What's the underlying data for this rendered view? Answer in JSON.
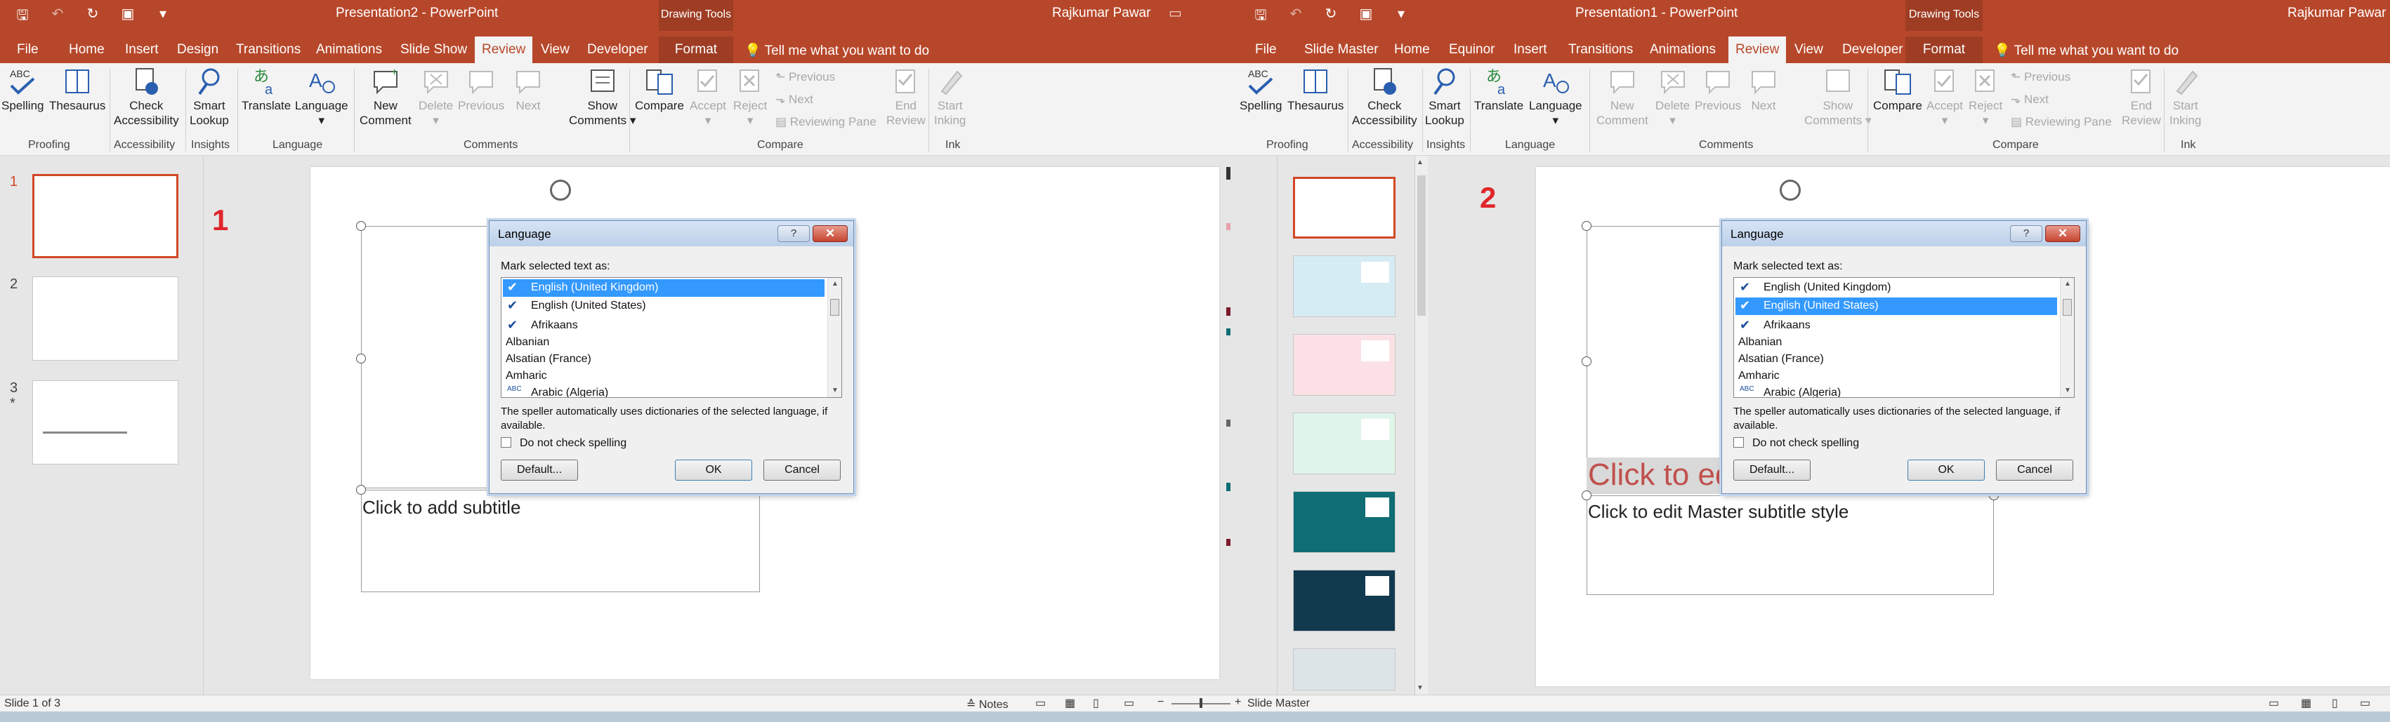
{
  "left_window": {
    "doc_title": "Presentation2 - PowerPoint",
    "context_title": "Drawing Tools",
    "user": "Rajkumar Pawar",
    "tabs": [
      "File",
      "Home",
      "Insert",
      "Design",
      "Transitions",
      "Animations",
      "Slide Show",
      "Review",
      "View",
      "Developer",
      "Format"
    ],
    "active_tab": "Review",
    "tell_me": "Tell me what you want to do",
    "slides": [
      "1",
      "2",
      "3"
    ],
    "slide3_marker": "*",
    "marker_number": "1",
    "subtitle_placeholder": "Click to add subtitle"
  },
  "right_window": {
    "doc_title": "Presentation1 - PowerPoint",
    "context_title": "Drawing Tools",
    "user": "Rajkumar Pawar",
    "tabs": [
      "File",
      "Slide Master",
      "Home",
      "Equinor",
      "Insert",
      "Transitions",
      "Animations",
      "Review",
      "View",
      "Developer",
      "Format"
    ],
    "active_tab": "Review",
    "tell_me": "Tell me what you want to do",
    "marker_number": "2",
    "title_placeholder": "Click to ed",
    "subtitle_placeholder": "Click to edit Master subtitle style"
  },
  "ribbon": {
    "spelling": "Spelling",
    "thesaurus": "Thesaurus",
    "check_accessibility_1": "Check",
    "check_accessibility_2": "Accessibility",
    "smart_lookup_1": "Smart",
    "smart_lookup_2": "Lookup",
    "translate": "Translate",
    "language": "Language",
    "new_comment_1": "New",
    "new_comment_2": "Comment",
    "delete": "Delete",
    "previous": "Previous",
    "next": "Next",
    "show_comments_1": "Show",
    "show_comments_2": "Comments",
    "compare": "Compare",
    "accept": "Accept",
    "reject": "Reject",
    "previous_small": "Previous",
    "next_small": "Next",
    "reviewing_pane": "Reviewing Pane",
    "end_review_1": "End",
    "end_review_2": "Review",
    "start_inking_1": "Start",
    "start_inking_2": "Inking",
    "groups": {
      "proofing": "Proofing",
      "accessibility": "Accessibility",
      "insights": "Insights",
      "language": "Language",
      "comments": "Comments",
      "compare": "Compare",
      "ink": "Ink"
    }
  },
  "dialog_left": {
    "title": "Language",
    "help": "?",
    "close": "✕",
    "label": "Mark selected text as:",
    "items": [
      {
        "name": "English (United Kingdom)",
        "check": "✔"
      },
      {
        "name": "English (United States)",
        "check": "✔"
      },
      {
        "name": "Afrikaans",
        "check": "✔"
      },
      {
        "name": "Albanian",
        "check": ""
      },
      {
        "name": "Alsatian (France)",
        "check": ""
      },
      {
        "name": "Amharic",
        "check": ""
      },
      {
        "name": "Arabic (Algeria)",
        "check": "ABC"
      }
    ],
    "selected_index": 0,
    "note": "The speller automatically uses dictionaries of the selected language, if available.",
    "do_not_check": "Do not check spelling",
    "default_btn": "Default...",
    "ok_btn": "OK",
    "cancel_btn": "Cancel"
  },
  "dialog_right": {
    "title": "Language",
    "help": "?",
    "close": "✕",
    "label": "Mark selected text as:",
    "items": [
      {
        "name": "English (United Kingdom)",
        "check": "✔"
      },
      {
        "name": "English (United States)",
        "check": "✔"
      },
      {
        "name": "Afrikaans",
        "check": "✔"
      },
      {
        "name": "Albanian",
        "check": ""
      },
      {
        "name": "Alsatian (France)",
        "check": ""
      },
      {
        "name": "Amharic",
        "check": ""
      },
      {
        "name": "Arabic (Algeria)",
        "check": "ABC"
      }
    ],
    "selected_index": 1,
    "note": "The speller automatically uses dictionaries of the selected language, if available.",
    "do_not_check": "Do not check spelling",
    "default_btn": "Default...",
    "ok_btn": "OK",
    "cancel_btn": "Cancel"
  },
  "status": {
    "slide_info": "Slide 1 of 3",
    "notes": "Notes",
    "view_label": "Slide Master"
  },
  "colors": {
    "ppt_red": "#b7472a",
    "context_red": "#9e3d24",
    "selection_blue": "#3399ff",
    "marker_red": "#e0262b"
  }
}
